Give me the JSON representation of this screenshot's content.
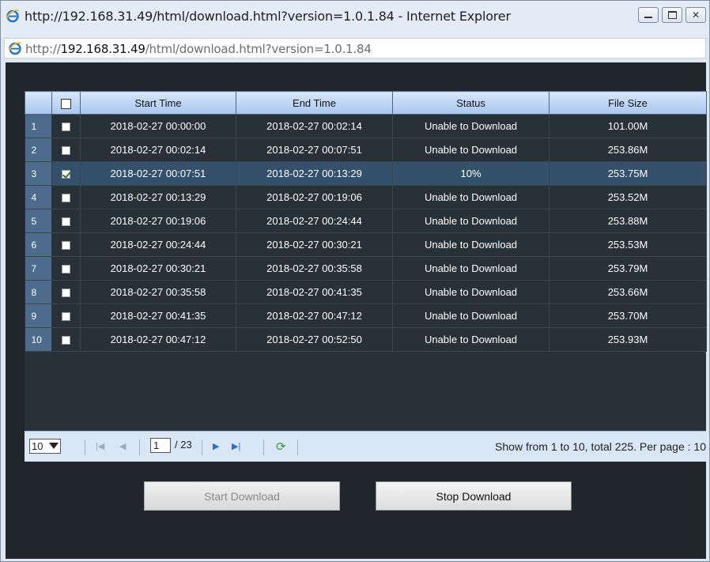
{
  "window": {
    "title": "http://192.168.31.49/html/download.html?version=1.0.1.84 - Internet Explorer",
    "address_prefix": "http://",
    "address_host": "192.168.31.49",
    "address_path": "/html/download.html?version=1.0.1.84"
  },
  "table": {
    "columns": [
      "Start Time",
      "End Time",
      "Status",
      "File Size"
    ],
    "rows": [
      {
        "num": "1",
        "start": "2018-02-27 00:00:00",
        "end": "2018-02-27 00:02:14",
        "status": "Unable to Download",
        "size": "101.00M",
        "checked": false
      },
      {
        "num": "2",
        "start": "2018-02-27 00:02:14",
        "end": "2018-02-27 00:07:51",
        "status": "Unable to Download",
        "size": "253.86M",
        "checked": false
      },
      {
        "num": "3",
        "start": "2018-02-27 00:07:51",
        "end": "2018-02-27 00:13:29",
        "status": "10%",
        "size": "253.75M",
        "checked": true
      },
      {
        "num": "4",
        "start": "2018-02-27 00:13:29",
        "end": "2018-02-27 00:19:06",
        "status": "Unable to Download",
        "size": "253.52M",
        "checked": false
      },
      {
        "num": "5",
        "start": "2018-02-27 00:19:06",
        "end": "2018-02-27 00:24:44",
        "status": "Unable to Download",
        "size": "253.88M",
        "checked": false
      },
      {
        "num": "6",
        "start": "2018-02-27 00:24:44",
        "end": "2018-02-27 00:30:21",
        "status": "Unable to Download",
        "size": "253.53M",
        "checked": false
      },
      {
        "num": "7",
        "start": "2018-02-27 00:30:21",
        "end": "2018-02-27 00:35:58",
        "status": "Unable to Download",
        "size": "253.79M",
        "checked": false
      },
      {
        "num": "8",
        "start": "2018-02-27 00:35:58",
        "end": "2018-02-27 00:41:35",
        "status": "Unable to Download",
        "size": "253.66M",
        "checked": false
      },
      {
        "num": "9",
        "start": "2018-02-27 00:41:35",
        "end": "2018-02-27 00:47:12",
        "status": "Unable to Download",
        "size": "253.70M",
        "checked": false
      },
      {
        "num": "10",
        "start": "2018-02-27 00:47:12",
        "end": "2018-02-27 00:52:50",
        "status": "Unable to Download",
        "size": "253.93M",
        "checked": false
      }
    ]
  },
  "pager": {
    "per_page_value": "10",
    "current_page": "1",
    "total_pages": "/ 23",
    "info": "Show from 1 to 10, total 225. Per page : 10"
  },
  "actions": {
    "start_download": "Start Download",
    "stop_download": "Stop Download"
  },
  "colors": {
    "content_bg": "#20262c",
    "header_bg": "#a9c7ef",
    "selected_row": "#34506a",
    "row_num_bg": "#4d6b8c"
  }
}
